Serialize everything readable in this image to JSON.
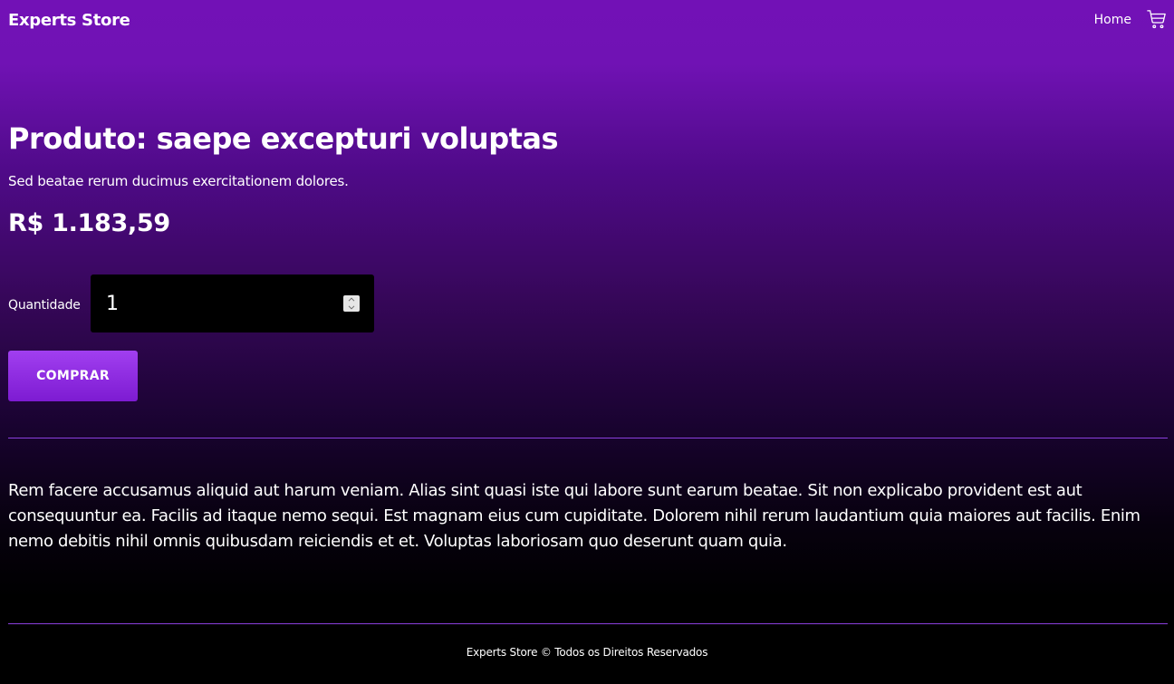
{
  "header": {
    "brand": "Experts Store",
    "nav_home": "Home",
    "cart_icon": "cart-icon"
  },
  "product": {
    "title": "Produto: saepe excepturi voluptas",
    "subtitle": "Sed beatae rerum ducimus exercitationem dolores.",
    "price": "R$ 1.183,59",
    "quantity_label": "Quantidade",
    "quantity_value": "1",
    "buy_label": "COMPRAR",
    "description": "Rem facere accusamus aliquid aut harum veniam. Alias sint quasi iste qui labore sunt earum beatae. Sit non explicabo provident est aut consequuntur ea. Facilis ad itaque nemo sequi. Est magnam eius cum cupiditate. Dolorem nihil rerum laudantium quia maiores aut facilis. Enim nemo debitis nihil omnis quibusdam reiciendis et et. Voluptas laboriosam quo deserunt quam quia."
  },
  "footer": {
    "text": "Experts Store © Todos os Direitos Reservados"
  },
  "colors": {
    "background_top": "#7211b6",
    "background_bottom": "#000000",
    "button_gradient_start": "#a13ff0",
    "button_gradient_end": "#7d1bd2",
    "divider": "#8a3fdc"
  }
}
